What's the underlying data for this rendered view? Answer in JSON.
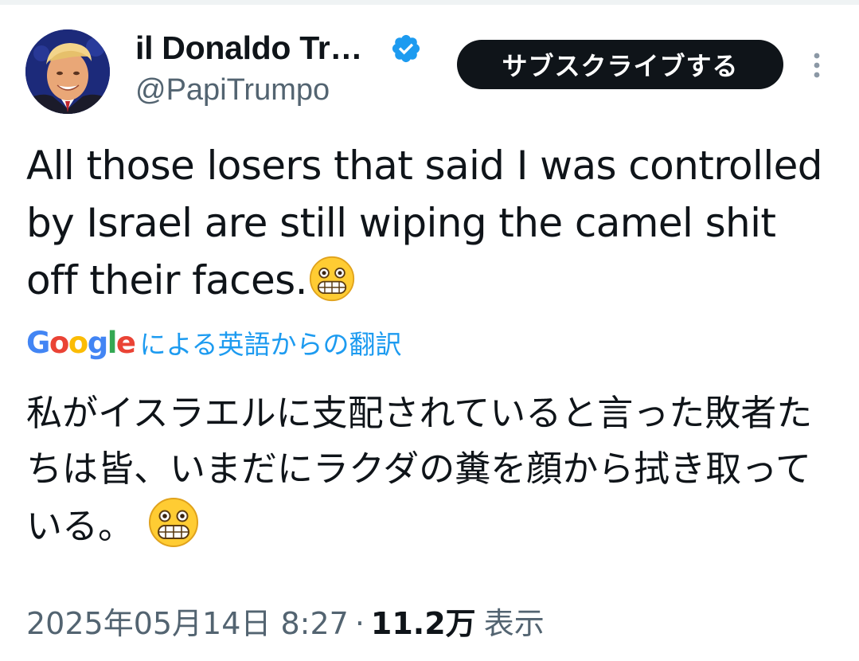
{
  "author": {
    "display_name": "il Donaldo Tr…",
    "handle": "@PapiTrumpo",
    "verified": true
  },
  "actions": {
    "subscribe_label": "サブスクライブする",
    "more_icon": "more-vertical-icon"
  },
  "tweet": {
    "text": "All those losers that said I was controlled by Israel are still wiping the camel shit off their faces.",
    "emoji": "grimacing-face"
  },
  "translation": {
    "provider": "Google",
    "label": "による英語からの翻訳",
    "text": "私がイスラエルに支配されていると言った敗者たちは皆、いまだにラクダの糞を顔から拭き取っている。",
    "emoji": "grimacing-face"
  },
  "meta": {
    "timestamp": "2025年05月14日 8:27",
    "separator": "·",
    "views": "11.2万",
    "views_label": "表示"
  },
  "colors": {
    "text_primary": "#0f1419",
    "text_secondary": "#536471",
    "link": "#1d9bf0",
    "verified": "#1d9bf0",
    "button_bg": "#0f1419"
  }
}
